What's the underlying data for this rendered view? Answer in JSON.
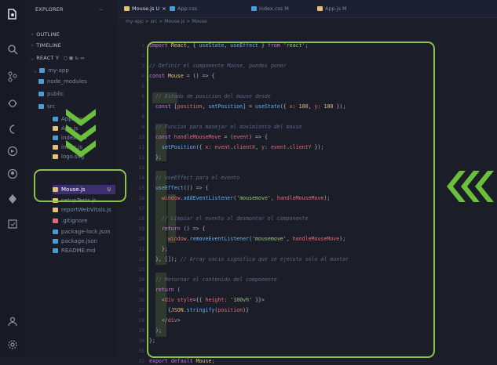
{
  "sidebar": {
    "header": "EXPLORER",
    "sections": [
      "OUTLINE",
      "TIMELINE"
    ],
    "project": "REACT Y",
    "root_folder": "my-app",
    "items": [
      {
        "label": "node_modules",
        "color": "#4a9bd6"
      },
      {
        "label": "public",
        "color": "#4a9bd6"
      },
      {
        "label": "src",
        "color": "#4a9bd6"
      },
      {
        "label": "App.css",
        "color": "#4a9bd6"
      },
      {
        "label": "App.js",
        "color": "#e5c07b"
      },
      {
        "label": "index.css",
        "color": "#4a9bd6"
      },
      {
        "label": "index.js",
        "color": "#e5c07b"
      },
      {
        "label": "logo.svg",
        "color": "#e5c07b"
      },
      {
        "label": "Mouse.js",
        "color": "#e5c07b",
        "badge": "U",
        "active": true
      },
      {
        "label": "setupTests.js",
        "color": "#e5c07b"
      },
      {
        "label": "reportWebVitals.js",
        "color": "#e5c07b"
      },
      {
        "label": ".gitignore",
        "color": "#e06c75"
      },
      {
        "label": "package-lock.json",
        "color": "#4a9bd6"
      },
      {
        "label": "package.json",
        "color": "#4a9bd6"
      },
      {
        "label": "README.md",
        "color": "#4a9bd6"
      }
    ]
  },
  "tabs": [
    {
      "label": "Mouse.js U",
      "color": "#e5c07b",
      "active": true
    },
    {
      "label": "App.css",
      "color": "#4a9bd6"
    },
    {
      "label": "index.css M",
      "color": "#4a9bd6"
    },
    {
      "label": "App.js M",
      "color": "#e5c07b"
    }
  ],
  "breadcrumb": "my-app > src > Mouse.js > Mouse",
  "code_lines": [
    "import React, { useState, useEffect } from 'react';",
    "",
    "// Definir el componente Mouse, puedes poner",
    "const Mouse = () => {",
    "",
    "  // Estado de posicion del mouse desde",
    "  const [position, setPosition] = useState({ x: 100, y: 100 });",
    "",
    "  // Funcion para manejar el movimiento del mouse",
    "  const handleMouseMove = (event) => {",
    "    setPosition({ x: event.clientX, y: event.clientY });",
    "  };",
    "",
    "  // useEffect para el evento",
    "  useEffect(() => {",
    "    window.addEventListener('mousemove', handleMouseMove);",
    "",
    "    // Limpiar el evento al desmontar el componente",
    "    return () => {",
    "      window.removeEventListener('mousemove', handleMouseMove);",
    "    };",
    "  }, []); // Array vacio significa que se ejecuta solo al montar",
    "",
    "  // Retornar el contenido del componente",
    "  return (",
    "    <div style={{ height: '100vh' }}>",
    "      {JSON.stringify(position)}",
    "    </div>",
    "  );",
    "};",
    "",
    "export default Mouse;"
  ],
  "annotation_color": "#8bc34a"
}
